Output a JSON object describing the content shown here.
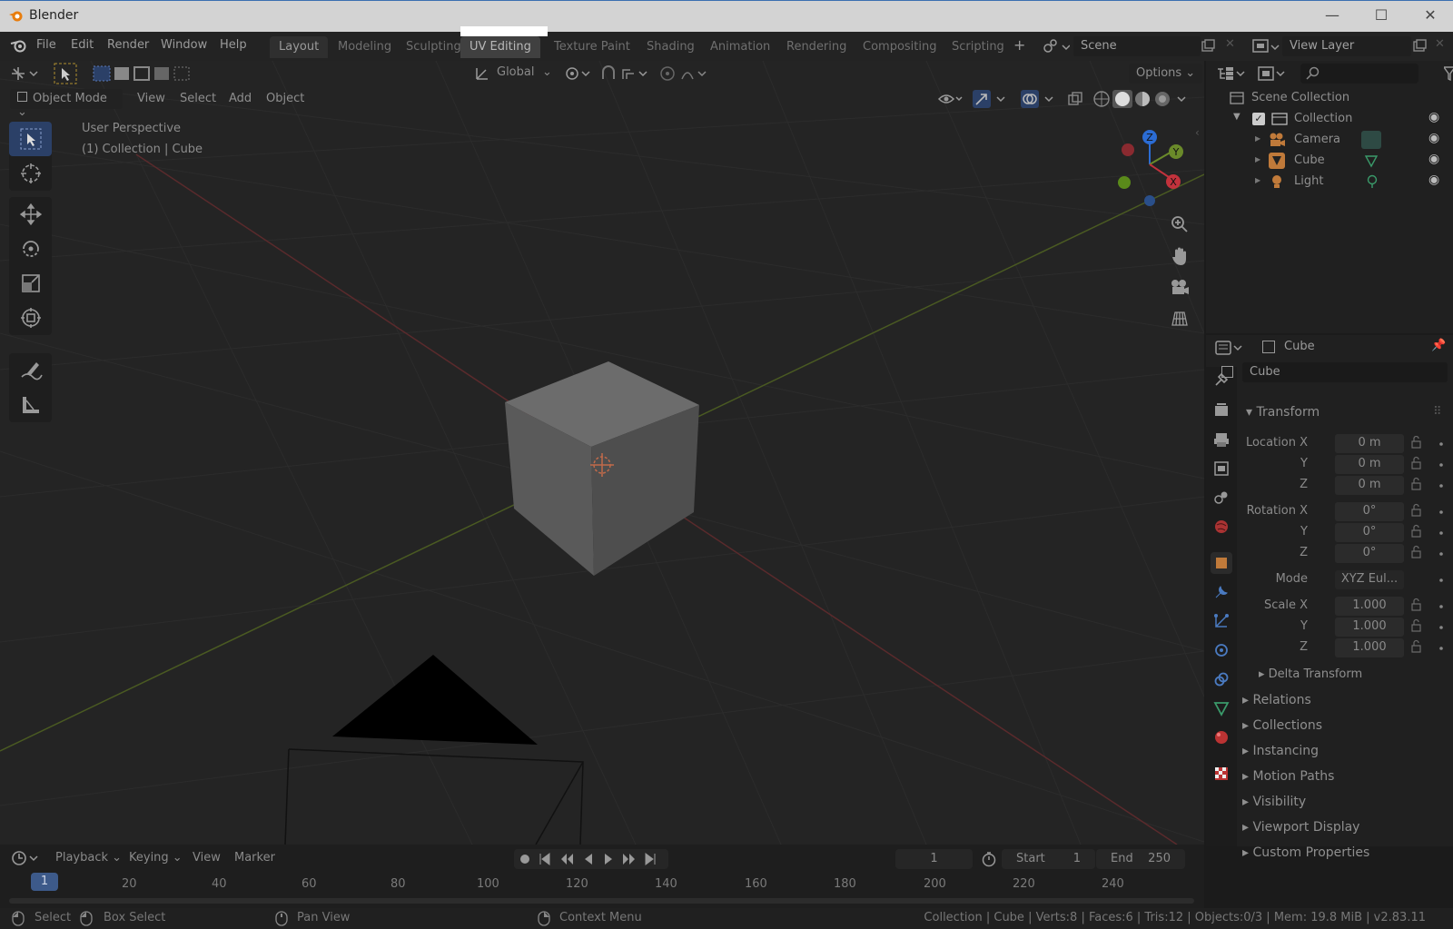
{
  "window": {
    "title": "Blender",
    "minimize": "—",
    "maximize": "☐",
    "close": "✕"
  },
  "menu": [
    "File",
    "Edit",
    "Render",
    "Window",
    "Help"
  ],
  "workspaces": [
    "Layout",
    "Modeling",
    "Sculpting",
    "UV Editing",
    "Texture Paint",
    "Shading",
    "Animation",
    "Rendering",
    "Compositing",
    "Scripting"
  ],
  "scene": {
    "name": "Scene",
    "view_layer": "View Layer"
  },
  "tool_header": {
    "orientation": "Global",
    "options": "Options"
  },
  "viewport_header": {
    "mode": "Object Mode",
    "menus": [
      "View",
      "Select",
      "Add",
      "Object"
    ]
  },
  "viewport": {
    "perspective": "User Perspective",
    "context": "(1) Collection | Cube"
  },
  "gizmo": {
    "z": "Z",
    "y": "Y",
    "x": "X"
  },
  "outliner": {
    "root": "Scene Collection",
    "collection": "Collection",
    "items": [
      {
        "name": "Camera",
        "icon": "camera-icon"
      },
      {
        "name": "Cube",
        "icon": "mesh-icon"
      },
      {
        "name": "Light",
        "icon": "light-icon"
      }
    ]
  },
  "properties": {
    "header_object": "Cube",
    "object_name": "Cube",
    "transform_title": "Transform",
    "location_label": "Location X",
    "rotation_label": "Rotation X",
    "mode_label": "Mode",
    "scale_label": "Scale X",
    "y": "Y",
    "z": "Z",
    "location": [
      "0 m",
      "0 m",
      "0 m"
    ],
    "rotation": [
      "0°",
      "0°",
      "0°"
    ],
    "mode": "XYZ Eul...",
    "scale": [
      "1.000",
      "1.000",
      "1.000"
    ],
    "delta": "Delta Transform",
    "sections": [
      "Relations",
      "Collections",
      "Instancing",
      "Motion Paths",
      "Visibility",
      "Viewport Display",
      "Custom Properties"
    ]
  },
  "timeline": {
    "menus": [
      "Playback",
      "Keying",
      "View",
      "Marker"
    ],
    "current_frame": "1",
    "start_label": "Start",
    "start": "1",
    "end_label": "End",
    "end": "250",
    "ruler": [
      "1",
      "20",
      "40",
      "60",
      "80",
      "100",
      "120",
      "140",
      "160",
      "180",
      "200",
      "220",
      "240"
    ]
  },
  "statusbar": {
    "select": "Select",
    "box_select": "Box Select",
    "pan_view": "Pan View",
    "context_menu": "Context Menu",
    "stats": "Collection | Cube | Verts:8 | Faces:6 | Tris:12 | Objects:0/3 | Mem: 19.8 MiB | v2.83.11"
  },
  "colors": {
    "accent": "#3d5a8a",
    "x_axis": "#c2323c",
    "y_axis": "#6a8a2a",
    "z_axis": "#2b6cd4"
  }
}
